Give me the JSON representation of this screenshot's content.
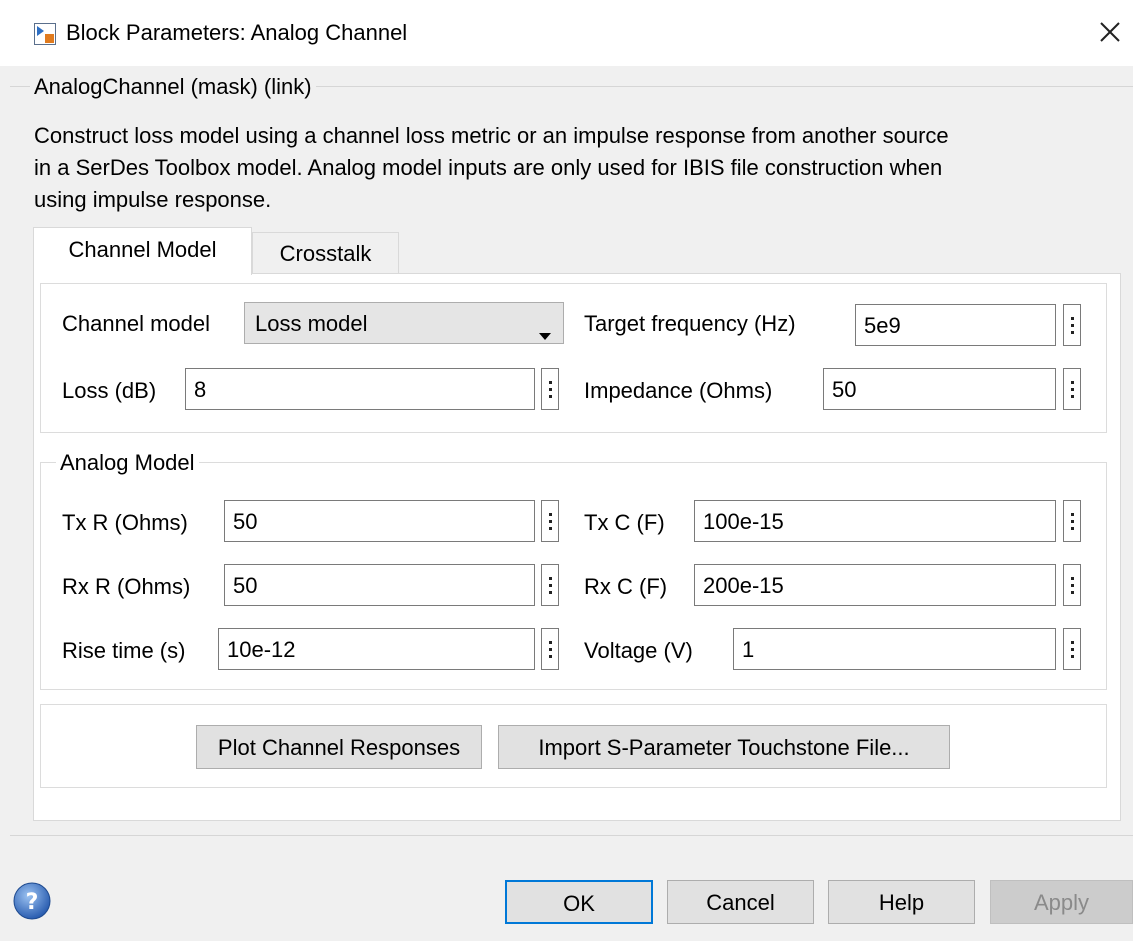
{
  "window": {
    "title": "Block Parameters: Analog Channel",
    "app_icon": "simulink-block-icon",
    "close_icon": "close-icon"
  },
  "mask_group": {
    "title": "AnalogChannel (mask) (link)",
    "description": "Construct loss model using a channel loss metric or an impulse response from another source\nin a SerDes Toolbox model.  Analog model inputs are only used for IBIS file construction when\nusing impulse response."
  },
  "tabs": [
    {
      "label": "Channel Model",
      "active": true
    },
    {
      "label": "Crosstalk",
      "active": false
    }
  ],
  "channel": {
    "model_label": "Channel model",
    "model_value": "Loss model",
    "target_freq_label": "Target frequency (Hz)",
    "target_freq_value": "5e9",
    "loss_label": "Loss (dB)",
    "loss_value": "8",
    "impedance_label": "Impedance (Ohms)",
    "impedance_value": "50"
  },
  "analog_model": {
    "title": "Analog Model",
    "tx_r_label": "Tx R (Ohms)",
    "tx_r_value": "50",
    "tx_c_label": "Tx C (F)",
    "tx_c_value": "100e-15",
    "rx_r_label": "Rx R (Ohms)",
    "rx_r_value": "50",
    "rx_c_label": "Rx C (F)",
    "rx_c_value": "200e-15",
    "rise_label": "Rise time (s)",
    "rise_value": "10e-12",
    "voltage_label": "Voltage (V)",
    "voltage_value": "1"
  },
  "actions": {
    "plot_label": "Plot Channel Responses",
    "import_label": "Import S-Parameter Touchstone File..."
  },
  "footer": {
    "help_icon": "question-icon",
    "ok_label": "OK",
    "cancel_label": "Cancel",
    "help_label": "Help",
    "apply_label": "Apply"
  },
  "colors": {
    "ok_border": "#0078d7",
    "window_bg": "#f0f0f0",
    "disabled_text": "#8a8a8a"
  }
}
